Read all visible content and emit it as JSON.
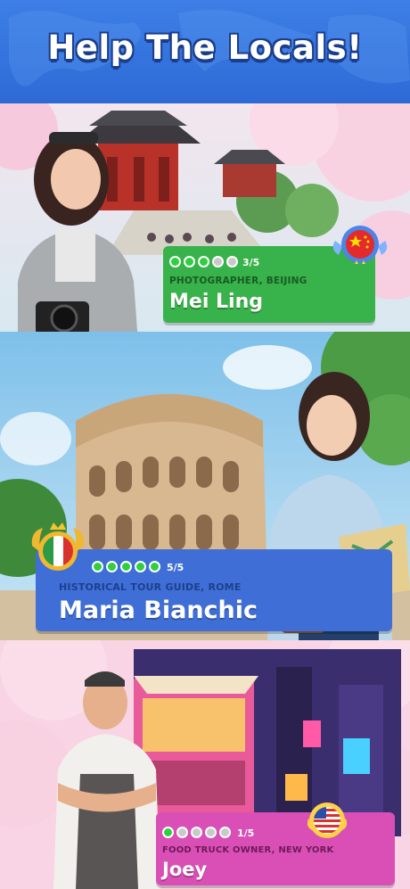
{
  "header": {
    "title": "Help The Locals!"
  },
  "characters": [
    {
      "name": "Mei Ling",
      "role": "PHOTOGRAPHER, BEIJING",
      "progress": "3/5",
      "completed": 3,
      "total": 5,
      "flag": "china-flag-icon",
      "banner_color": "#38b24a"
    },
    {
      "name": "Maria Bianchic",
      "role": "HISTORICAL TOUR GUIDE, ROME",
      "progress": "5/5",
      "completed": 5,
      "total": 5,
      "flag": "italy-flag-icon",
      "banner_color": "#3f6fd6"
    },
    {
      "name": "Joey",
      "role": "FOOD TRUCK OWNER, NEW YORK",
      "progress": "1/5",
      "completed": 1,
      "total": 5,
      "flag": "usa-flag-icon",
      "banner_color": "#d94fb5"
    }
  ]
}
